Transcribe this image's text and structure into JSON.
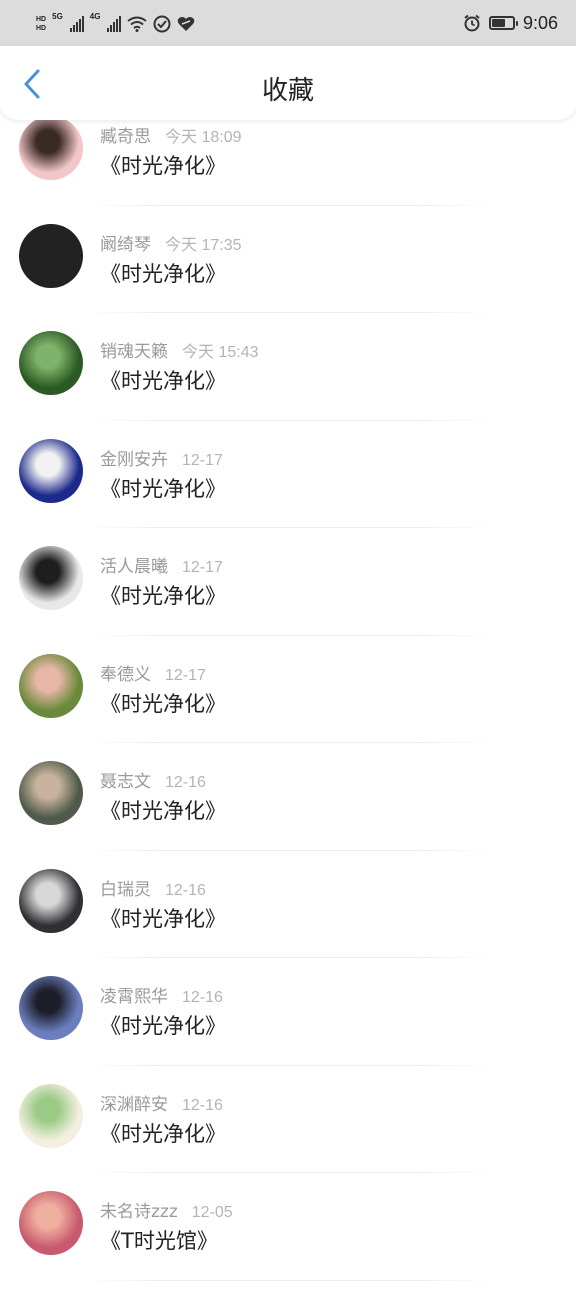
{
  "status_bar": {
    "left_indicators": [
      "HD",
      "5G",
      "4G"
    ],
    "time": "9:06",
    "icons": [
      "hd-icon",
      "signal-icon",
      "wifi-icon",
      "vpn-icon",
      "heart-shield-icon",
      "alarm-icon",
      "battery-icon"
    ]
  },
  "header": {
    "title": "收藏",
    "back_icon": "chevron-left-icon",
    "accent_color": "#4a90e2"
  },
  "favorites": [
    {
      "name": "臧奇思",
      "date": "今天 18:09",
      "title": "《时光净化》",
      "avatar_colors": [
        "#f3c7c9",
        "#3a2a26"
      ]
    },
    {
      "name": "阚绮琴",
      "date": "今天 17:35",
      "title": "《时光净化》",
      "avatar_colors": [
        "#222222",
        "#222222"
      ]
    },
    {
      "name": "销魂天籁",
      "date": "今天 15:43",
      "title": "《时光净化》",
      "avatar_colors": [
        "#2c5a24",
        "#7fb26a"
      ]
    },
    {
      "name": "金刚安卉",
      "date": "12-17",
      "title": "《时光净化》",
      "avatar_colors": [
        "#1c2a8c",
        "#f2f2f2"
      ]
    },
    {
      "name": "活人晨曦",
      "date": "12-17",
      "title": "《时光净化》",
      "avatar_colors": [
        "#e8e8e8",
        "#1e1e1e"
      ]
    },
    {
      "name": "奉德义",
      "date": "12-17",
      "title": "《时光净化》",
      "avatar_colors": [
        "#6a8a3a",
        "#e9b7a6"
      ]
    },
    {
      "name": "聂志文",
      "date": "12-16",
      "title": "《时光净化》",
      "avatar_colors": [
        "#4f5a4a",
        "#c9b39e"
      ]
    },
    {
      "name": "白瑞灵",
      "date": "12-16",
      "title": "《时光净化》",
      "avatar_colors": [
        "#2f3033",
        "#d8d8d8"
      ]
    },
    {
      "name": "凌霄熙华",
      "date": "12-16",
      "title": "《时光净化》",
      "avatar_colors": [
        "#6b7fc0",
        "#1e1e2a"
      ]
    },
    {
      "name": "深渊醉安",
      "date": "12-16",
      "title": "《时光净化》",
      "avatar_colors": [
        "#f4efe0",
        "#9acb86"
      ]
    },
    {
      "name": "未名诗zzz",
      "date": "12-05",
      "title": "《T时光馆》",
      "avatar_colors": [
        "#c85a6e",
        "#f0b0a0"
      ]
    }
  ]
}
